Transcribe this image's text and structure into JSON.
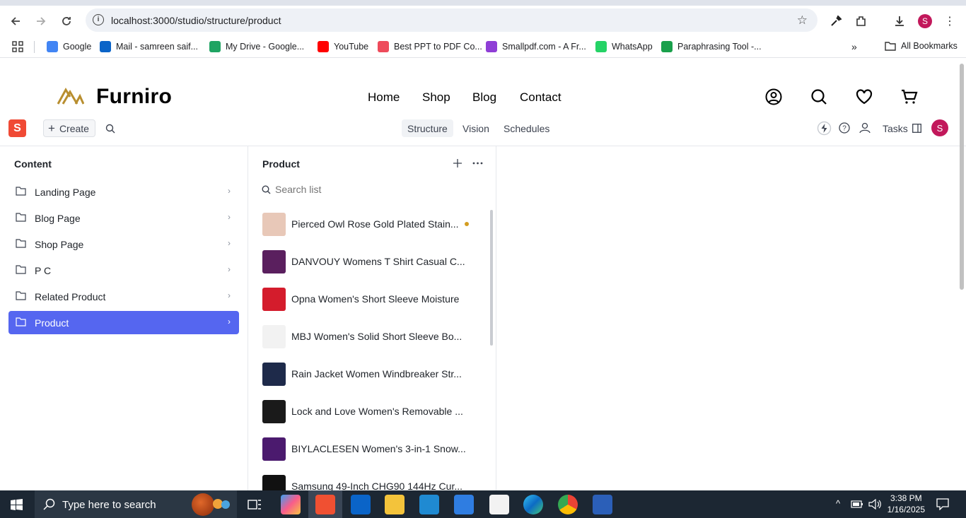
{
  "browser": {
    "url": "localhost:3000/studio/structure/product",
    "bookmarks": [
      {
        "label": "Google",
        "icon": "google-icon",
        "color": "#4285f4"
      },
      {
        "label": "Mail - samreen saif...",
        "icon": "outlook-icon",
        "color": "#0a64c8"
      },
      {
        "label": "My Drive - Google...",
        "icon": "drive-icon",
        "color": "#1fa463"
      },
      {
        "label": "YouTube",
        "icon": "youtube-icon",
        "color": "#ff0000"
      },
      {
        "label": "Best PPT to PDF Co...",
        "icon": "ppt-pdf-icon",
        "color": "#ee4b5b"
      },
      {
        "label": "Smallpdf.com - A Fr...",
        "icon": "smallpdf-icon",
        "color": "#8f3ed6"
      },
      {
        "label": "WhatsApp",
        "icon": "whatsapp-icon",
        "color": "#25d366"
      },
      {
        "label": "Paraphrasing Tool -...",
        "icon": "quillbot-icon",
        "color": "#19a04b"
      }
    ],
    "all_bookmarks": "All Bookmarks",
    "profile_initial": "S"
  },
  "site": {
    "brand": "Furniro",
    "brand_color": "#b88e2f",
    "nav": [
      "Home",
      "Shop",
      "Blog",
      "Contact"
    ]
  },
  "studio": {
    "logo_letter": "S",
    "create_label": "Create",
    "tabs": [
      "Structure",
      "Vision",
      "Schedules"
    ],
    "active_tab": "Structure",
    "tasks_label": "Tasks",
    "user_initial": "S",
    "accent": "#5566f0"
  },
  "content_pane": {
    "title": "Content",
    "items": [
      "Landing Page",
      "Blog Page",
      "Shop Page",
      "P C",
      "Related Product",
      "Product"
    ],
    "selected": "Product"
  },
  "product_pane": {
    "title": "Product",
    "search_placeholder": "Search list",
    "items": [
      {
        "label": "Pierced Owl Rose Gold Plated Stain...",
        "thumb": "#e8c8b8",
        "changed": true
      },
      {
        "label": "DANVOUY Womens T Shirt Casual C...",
        "thumb": "#5a1f5e",
        "changed": false
      },
      {
        "label": "Opna Women's Short Sleeve Moisture",
        "thumb": "#d41c2c",
        "changed": false
      },
      {
        "label": "MBJ Women's Solid Short Sleeve Bo...",
        "thumb": "#f2f2f2",
        "changed": false
      },
      {
        "label": "Rain Jacket Women Windbreaker Str...",
        "thumb": "#1e2a4a",
        "changed": false
      },
      {
        "label": "Lock and Love Women's Removable ...",
        "thumb": "#1a1a1a",
        "changed": false
      },
      {
        "label": "BIYLACLESEN Women's 3-in-1 Snow...",
        "thumb": "#4b1a6e",
        "changed": false
      },
      {
        "label": "Samsung 49-Inch CHG90 144Hz Cur...",
        "thumb": "#111111",
        "changed": false
      }
    ]
  },
  "taskbar": {
    "search_placeholder": "Type here to search",
    "time": "3:38 PM",
    "date": "1/16/2025"
  }
}
